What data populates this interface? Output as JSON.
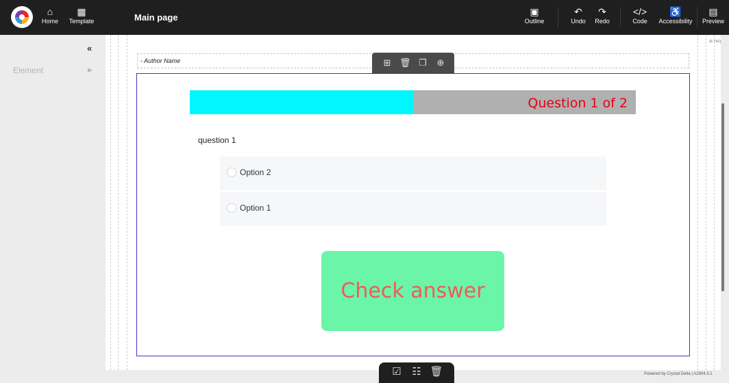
{
  "header": {
    "home_label": "Home",
    "template_label": "Template",
    "page_title": "Main page",
    "outline_label": "Outline",
    "undo_label": "Undo",
    "redo_label": "Redo",
    "code_label": "Code",
    "accessibility_label": "Accessibility",
    "preview_label": "Preview"
  },
  "sidebar": {
    "collapse_icon": "«",
    "element_label": "Element"
  },
  "canvas": {
    "author_name": "- Author Name",
    "progress_text": "Question 1 of 2",
    "progress_fraction": 0.5,
    "question": "question 1",
    "options": [
      "Option 2",
      "Option 1"
    ],
    "check_button": "Check answer",
    "help_label": "Help"
  },
  "colors": {
    "progress_fill": "#00f7ff",
    "progress_track": "#b0b0b0",
    "progress_text": "#e8000f",
    "check_button_bg": "#6bf5a8",
    "check_button_text": "#f25a5a",
    "quiz_border": "#4a2fc9"
  },
  "footer": {
    "powered_by": "Powered by Crystal Delta",
    "version": "A2804.3.1"
  }
}
